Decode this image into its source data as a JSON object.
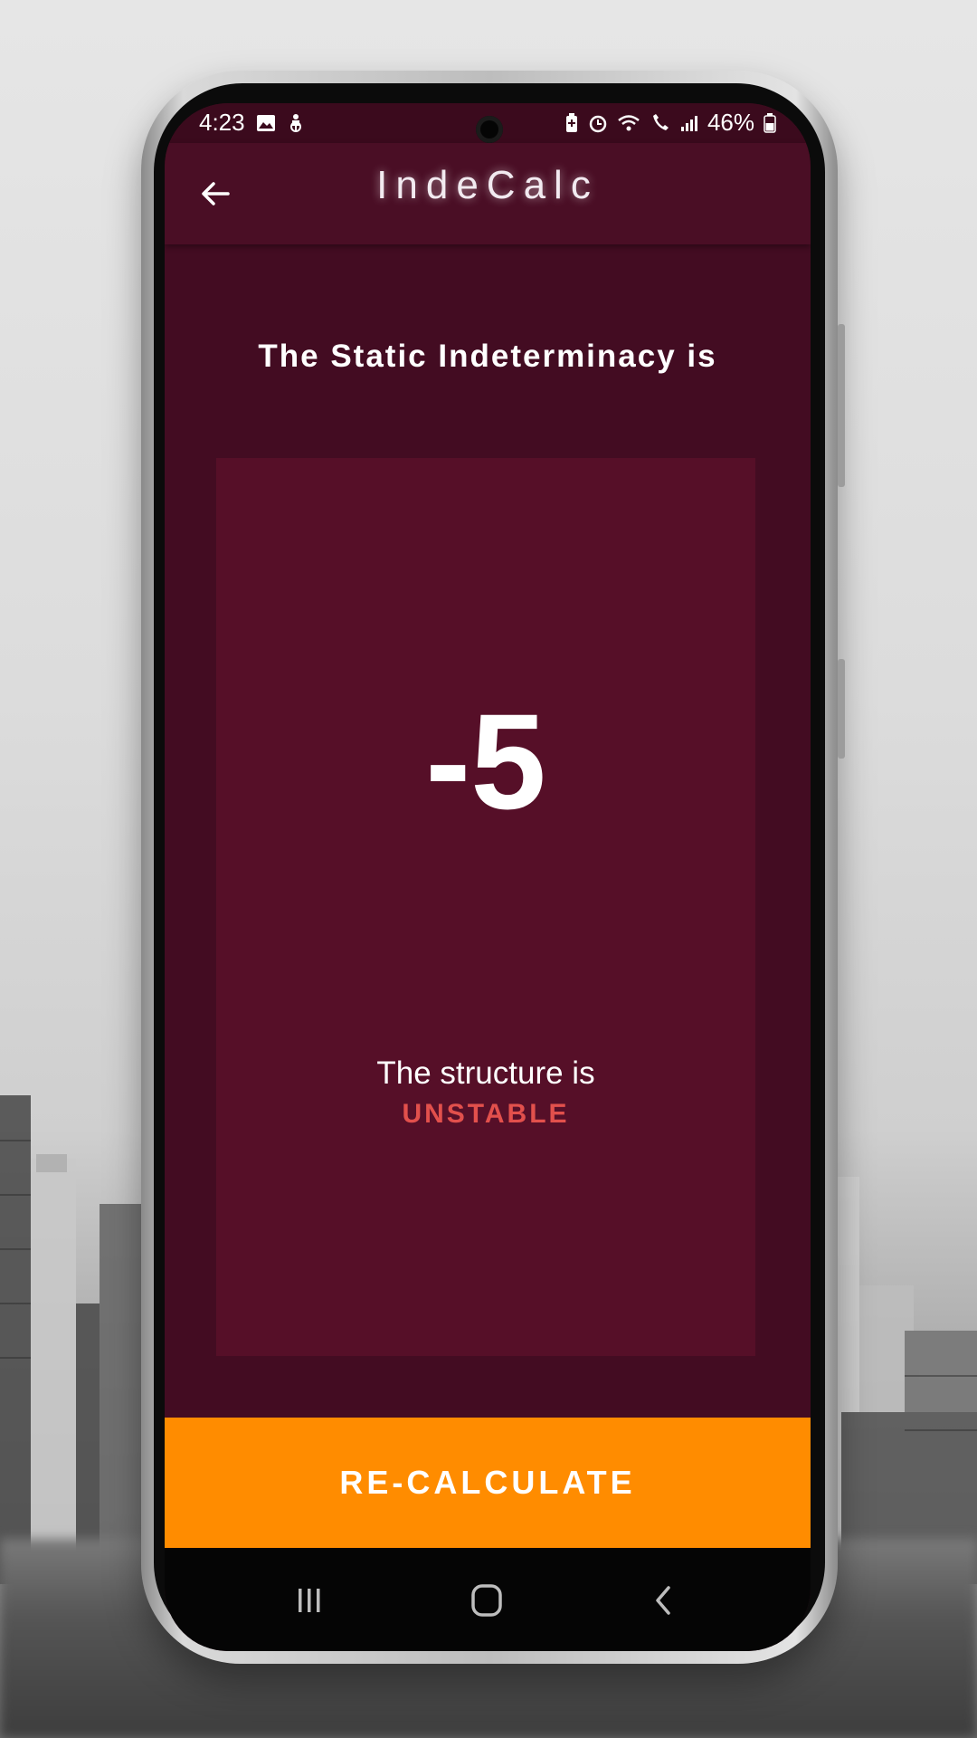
{
  "status_bar": {
    "time": "4:23",
    "battery": "46%",
    "left_icons": [
      "image-icon",
      "accessibility-icon"
    ],
    "right_icons": [
      "battery-saver-icon",
      "alarm-icon",
      "wifi-icon",
      "wifi-calling-icon",
      "signal-icon",
      "battery-icon"
    ]
  },
  "app_bar": {
    "title": "IndeCalc",
    "back_icon": "arrow-left-icon"
  },
  "result": {
    "heading": "The Static Indeterminacy is",
    "value": "-5",
    "structure_text": "The structure is",
    "structure_status": "UNSTABLE"
  },
  "actions": {
    "recalculate_label": "RE-CALCULATE"
  },
  "nav_bar": {
    "icons": [
      "recents-icon",
      "home-icon",
      "back-icon"
    ]
  },
  "colors": {
    "primary_dark": "#430c22",
    "app_bar": "#4a0e25",
    "card": "#560f28",
    "accent": "#ff8c00",
    "error": "#e2504c"
  }
}
